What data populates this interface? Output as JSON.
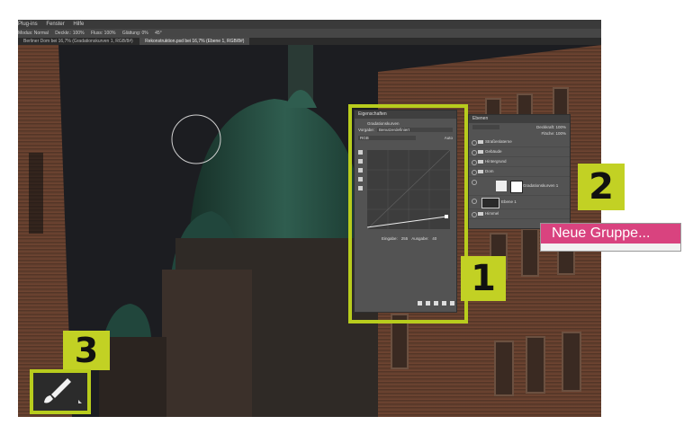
{
  "menubar": {
    "items": [
      "Plug-ins",
      "Fenster",
      "Hilfe"
    ]
  },
  "options_bar": {
    "items": [
      "Modus: Normal",
      "Deckkr.: 100%",
      "Fluss: 100%",
      "Glättung: 0%",
      "45°"
    ]
  },
  "tabs": [
    {
      "label": "Berliner Dom bei 16,7% (Gradationskurven 1, RGB/8#)",
      "active": false
    },
    {
      "label": "Rekonstruktion.psd bei 16,7% (Ebene 1, RGB/8#)",
      "active": true
    }
  ],
  "properties_panel": {
    "title": "Eigenschaften",
    "subtitle": "Gradationskurven",
    "preset_label": "Vorgabe:",
    "preset_value": "Benutzerdefiniert",
    "channel_value": "RGB",
    "auto_label": "Auto",
    "input_label": "Eingabe:",
    "input_value": "255",
    "output_label": "Ausgabe:",
    "output_value": "40"
  },
  "layers_panel": {
    "title": "Ebenen",
    "opacity_label": "Deckkraft: 100%",
    "fill_label": "Fläche: 100%",
    "layers": [
      "Straßenlaterne",
      "Gebäude",
      "Hintergrund",
      "Dom",
      "Ebene 1",
      "Himmel"
    ],
    "adjustment_layer_name": "Gradationskurven 1"
  },
  "context_menu": {
    "item": "Neue Gruppe..."
  },
  "callouts": {
    "one": "1",
    "two": "2",
    "three": "3"
  },
  "icons": {
    "brush": "brush-icon"
  },
  "colors": {
    "accent": "#b8cc1d",
    "menu_highlight": "#d9437f",
    "canvas_bg": "#1b1c1f"
  }
}
